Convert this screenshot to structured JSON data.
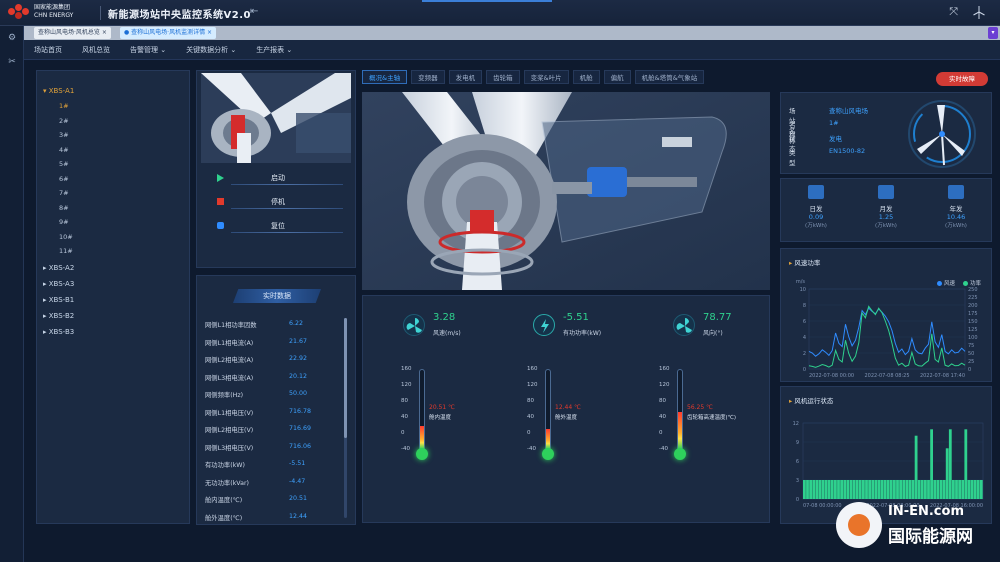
{
  "header": {
    "company_cn": "国家能源集团",
    "company_en": "CHN ENERGY",
    "title": "新能源场站中央监控系统V2.0",
    "menu_icon": "menu-collapse-icon",
    "right_icons": [
      "fullscreen-icon",
      "wind-turbine-icon"
    ]
  },
  "sidebar_icons": [
    "gear-icon",
    "tools-icon"
  ],
  "tabs": [
    {
      "label": "查称山风电场·风机总览"
    },
    {
      "label": "查称山风电场·风机监测详情"
    }
  ],
  "nav": [
    "场站首页",
    "风机总览",
    "告警管理 ⌄",
    "关键数据分析 ⌄",
    "生产报表 ⌄"
  ],
  "tree": {
    "groups": [
      "XBS-A1",
      "XBS-A2",
      "XBS-A3",
      "XBS-B1",
      "XBS-B2",
      "XBS-B3"
    ],
    "a1_units": [
      "1#",
      "2#",
      "3#",
      "4#",
      "5#",
      "6#",
      "7#",
      "8#",
      "9#",
      "10#",
      "11#"
    ]
  },
  "controls": {
    "start": "启动",
    "stop": "停机",
    "reset": "复位"
  },
  "realtime": {
    "title": "实时数据",
    "rows": [
      {
        "k": "网侧L1相功率因数",
        "v": "6.22"
      },
      {
        "k": "网侧L1相电流(A)",
        "v": "21.67"
      },
      {
        "k": "网侧L2相电流(A)",
        "v": "22.92"
      },
      {
        "k": "网侧L3相电流(A)",
        "v": "20.12"
      },
      {
        "k": "网侧频率(Hz)",
        "v": "50.00"
      },
      {
        "k": "网侧L1相电压(V)",
        "v": "716.78"
      },
      {
        "k": "网侧L2相电压(V)",
        "v": "716.69"
      },
      {
        "k": "网侧L3相电压(V)",
        "v": "716.06"
      },
      {
        "k": "有功功率(kW)",
        "v": "-5.51"
      },
      {
        "k": "无功功率(kVar)",
        "v": "-4.47"
      },
      {
        "k": "舱内温度(℃)",
        "v": "20.51"
      },
      {
        "k": "舱外温度(℃)",
        "v": "12.44"
      }
    ]
  },
  "subtabs": [
    "概况&主轴",
    "变频器",
    "发电机",
    "齿轮箱",
    "变桨&叶片",
    "机舱",
    "偏航",
    "机舱&塔筒&气象站"
  ],
  "live_button": "实时故障",
  "metrics": [
    {
      "value": "3.28",
      "name": "风速(m/s)",
      "icon": "fan-icon"
    },
    {
      "value": "-5.51",
      "name": "有功功率(kW)",
      "icon": "power-icon"
    },
    {
      "value": "78.77",
      "name": "风向(°)",
      "icon": "wind-direction-icon"
    }
  ],
  "thermo_axis": [
    "160",
    "120",
    "80",
    "40",
    "0",
    "-40"
  ],
  "thermometers": [
    {
      "value": "20.51 ℃",
      "name": "舱内温度",
      "level": 0.3
    },
    {
      "value": "12.44 ℃",
      "name": "舱外温度",
      "level": 0.26
    },
    {
      "value": "56.25 ℃",
      "name": "齿轮箱高速温度(℃)",
      "level": 0.48
    }
  ],
  "info": {
    "rows": [
      {
        "k": "场站名称",
        "v": "查称山风电场"
      },
      {
        "k": "名称",
        "v": "1#"
      },
      {
        "k": "状态",
        "v": "发电"
      },
      {
        "k": "类型",
        "v": "EN1500-82"
      }
    ]
  },
  "energy": [
    {
      "name": "日发",
      "value": "0.09",
      "unit": "(万kWh)"
    },
    {
      "name": "月发",
      "value": "1.25",
      "unit": "(万kWh)"
    },
    {
      "name": "年发",
      "value": "10.46",
      "unit": "(万kWh)"
    }
  ],
  "chart_data": [
    {
      "type": "line",
      "title": "风速功率",
      "legend": [
        "风速",
        "功率"
      ],
      "ylabel_left": "m/s",
      "ylim_left": [
        0,
        10
      ],
      "ylim_right": [
        0,
        250
      ],
      "yticks_left": [
        "0",
        "2",
        "4",
        "6",
        "8",
        "10"
      ],
      "yticks_right": [
        "0",
        "25",
        "50",
        "75",
        "100",
        "125",
        "150",
        "175",
        "200",
        "225",
        "250"
      ],
      "xticks": [
        "2022-07-08 00:00",
        "2022-07-08 08:25",
        "2022-07-08 17:40"
      ],
      "series": [
        {
          "name": "风速",
          "color": "#2f8cff",
          "values": [
            2.2,
            2.0,
            1.6,
            1.9,
            2.4,
            2.1,
            1.7,
            2.3,
            4.5,
            3.2,
            2.8,
            5.6,
            4.0,
            2.9,
            3.6,
            5.2,
            7.3,
            6.8,
            7.6,
            7.2,
            6.9,
            7.5,
            7.1,
            6.6,
            5.9,
            4.8,
            3.2,
            2.1,
            2.5,
            1.8,
            2.2,
            3.8,
            2.4,
            2.0,
            1.9,
            2.6,
            3.1,
            5.9,
            3.4,
            2.7,
            4.3,
            2.2,
            1.9,
            2.4,
            2.0,
            2.1,
            2.6,
            2.2
          ]
        },
        {
          "name": "功率",
          "color": "#2fd18e",
          "values": [
            10,
            8,
            5,
            9,
            14,
            11,
            6,
            12,
            58,
            30,
            22,
            90,
            48,
            24,
            40,
            82,
            175,
            160,
            196,
            182,
            170,
            190,
            176,
            150,
            120,
            80,
            34,
            12,
            18,
            8,
            12,
            52,
            16,
            10,
            9,
            18,
            26,
            110,
            30,
            22,
            66,
            12,
            8,
            16,
            10,
            11,
            18,
            12
          ]
        }
      ]
    },
    {
      "type": "bar",
      "title": "风机运行状态",
      "ylim": [
        0,
        12
      ],
      "yticks": [
        "0",
        "3",
        "6",
        "9",
        "12"
      ],
      "xticks": [
        "07-08 00:00:00",
        "2022-07-08 08:00:00",
        "2022-07-08 16:00:00"
      ],
      "series": [
        {
          "name": "状态",
          "color": "#2fd18e",
          "values": [
            3,
            3,
            3,
            3,
            3,
            3,
            3,
            3,
            3,
            3,
            3,
            3,
            3,
            3,
            3,
            3,
            3,
            3,
            3,
            3,
            3,
            3,
            3,
            3,
            3,
            3,
            3,
            3,
            3,
            3,
            3,
            3,
            3,
            3,
            3,
            3,
            10,
            3,
            3,
            3,
            3,
            11,
            3,
            3,
            3,
            3,
            8,
            11,
            3,
            3,
            3,
            3,
            11,
            3,
            3,
            3,
            3,
            3
          ]
        }
      ]
    }
  ],
  "watermark": {
    "line1": "IN-EN.com",
    "line2": "国际能源网"
  }
}
